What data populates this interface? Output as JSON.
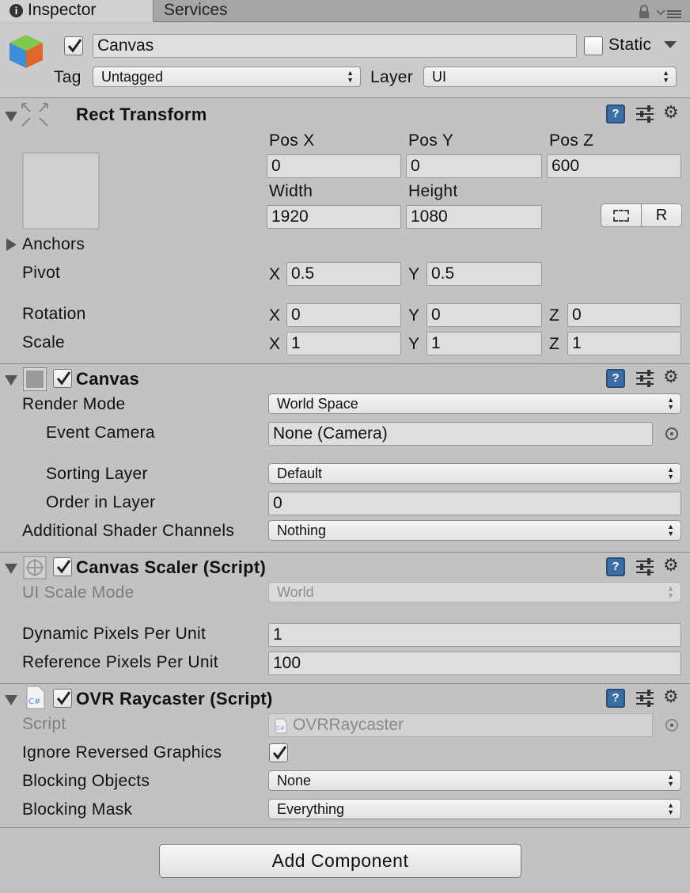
{
  "tabs": [
    {
      "label": "Inspector",
      "active": true
    },
    {
      "label": "Services",
      "active": false
    }
  ],
  "header": {
    "object_name": "Canvas",
    "active_checked": true,
    "static_label": "Static",
    "static_checked": false,
    "tag_label": "Tag",
    "tag_value": "Untagged",
    "layer_label": "Layer",
    "layer_value": "UI"
  },
  "rect_transform": {
    "title": "Rect Transform",
    "pos_x_label": "Pos X",
    "pos_x": "0",
    "pos_y_label": "Pos Y",
    "pos_y": "0",
    "pos_z_label": "Pos Z",
    "pos_z": "600",
    "width_label": "Width",
    "width": "1920",
    "height_label": "Height",
    "height": "1080",
    "raw_edit_button": "R",
    "anchors_label": "Anchors",
    "pivot_label": "Pivot",
    "pivot_x": "0.5",
    "pivot_y": "0.5",
    "rotation_label": "Rotation",
    "rot_x": "0",
    "rot_y": "0",
    "rot_z": "0",
    "scale_label": "Scale",
    "scale_x": "1",
    "scale_y": "1",
    "scale_z": "1",
    "x_axis": "X",
    "y_axis": "Y",
    "z_axis": "Z"
  },
  "canvas": {
    "title": "Canvas",
    "enabled": true,
    "render_mode_label": "Render Mode",
    "render_mode": "World Space",
    "event_camera_label": "Event Camera",
    "event_camera": "None (Camera)",
    "sorting_layer_label": "Sorting Layer",
    "sorting_layer": "Default",
    "order_label": "Order in Layer",
    "order": "0",
    "shader_channels_label": "Additional Shader Channels",
    "shader_channels": "Nothing"
  },
  "canvas_scaler": {
    "title": "Canvas Scaler (Script)",
    "enabled": true,
    "ui_scale_mode_label": "UI Scale Mode",
    "ui_scale_mode": "World",
    "dynamic_ppu_label": "Dynamic Pixels Per Unit",
    "dynamic_ppu": "1",
    "reference_ppu_label": "Reference Pixels Per Unit",
    "reference_ppu": "100"
  },
  "ovr_raycaster": {
    "title": "OVR Raycaster (Script)",
    "enabled": true,
    "script_label": "Script",
    "script": "OVRRaycaster",
    "script_icon_text": "C#",
    "ignore_reversed_label": "Ignore Reversed Graphics",
    "ignore_reversed": true,
    "blocking_objects_label": "Blocking Objects",
    "blocking_objects": "None",
    "blocking_mask_label": "Blocking Mask",
    "blocking_mask": "Everything"
  },
  "help_icon_text": "?",
  "add_component_label": "Add Component",
  "colors": {
    "background": "#c2c2c2",
    "field": "#dedede",
    "help_icon": "#3a6ea5"
  }
}
